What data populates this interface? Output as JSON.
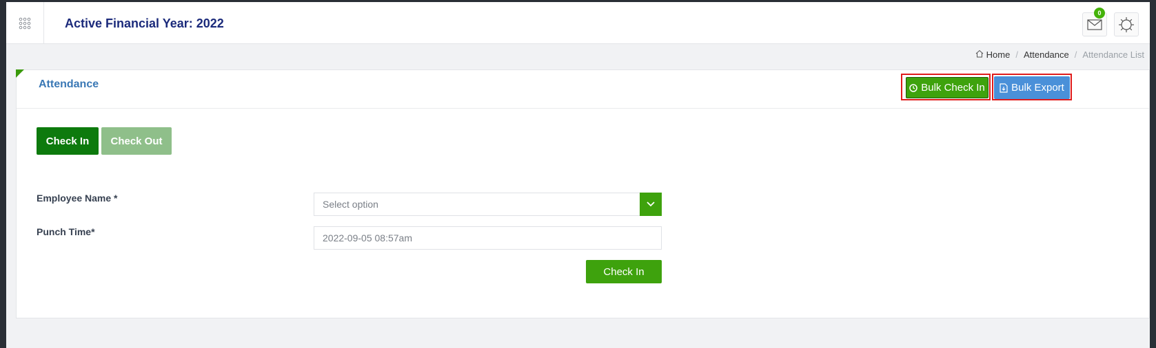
{
  "header": {
    "title": "Active Financial Year: 2022",
    "notification_count": "0",
    "menu_icon": "grid-dots-icon",
    "mail_icon": "mail-icon",
    "settings_icon": "gear-icon"
  },
  "breadcrumb": {
    "home": "Home",
    "section": "Attendance",
    "current": "Attendance List"
  },
  "card": {
    "title": "Attendance",
    "bulk_check_in_label": "Bulk Check In",
    "bulk_export_label": "Bulk Export"
  },
  "tabs": [
    {
      "label": "Check In",
      "active": true
    },
    {
      "label": "Check Out",
      "active": false
    }
  ],
  "form": {
    "employee_label": "Employee Name *",
    "employee_placeholder": "Select option",
    "punch_label": "Punch Time*",
    "punch_value": "2022-09-05 08:57am",
    "submit_label": "Check In"
  },
  "colors": {
    "primary_green": "#3ea20d",
    "tab_active": "#0d7a0d",
    "tab_inactive": "#8fbf8a",
    "export_blue": "#4a90d9",
    "highlight_red": "#e01a1a",
    "title_navy": "#1b2a7b"
  }
}
